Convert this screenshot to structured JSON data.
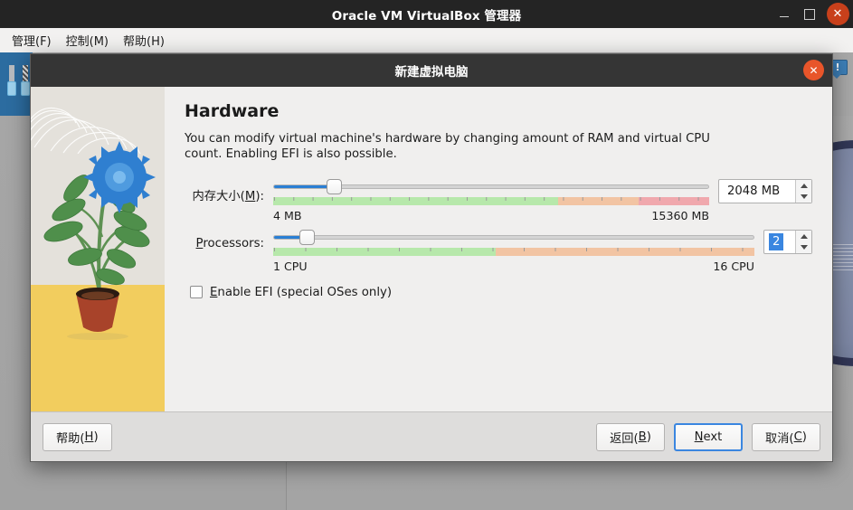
{
  "background_window": {
    "title": "Oracle VM VirtualBox 管理器",
    "window_controls": {
      "minimize": "–",
      "maximize": "□",
      "close": "✕"
    },
    "menu": [
      {
        "label": "管理(F)",
        "mnemonic": "F"
      },
      {
        "label": "控制(M)",
        "mnemonic": "M"
      },
      {
        "label": "帮助(H)",
        "mnemonic": "H"
      }
    ],
    "notification_icon": "!",
    "icons": {
      "toolbar": "tools-icon",
      "notification": "notification-bubble-icon",
      "logo": "virtualbox-logo-icon"
    }
  },
  "dialog": {
    "title": "新建虚拟电脑",
    "close_label": "✕",
    "page_title": "Hardware",
    "page_description": "You can modify virtual machine's hardware by changing amount of RAM and virtual CPU count. Enabling EFI is also possible.",
    "memory": {
      "label": "内存大小(M):",
      "label_main": "内存大小(",
      "label_mnemonic": "M",
      "label_tail": "):",
      "value": "2048 MB",
      "min_label": "4 MB",
      "max_label": "15360 MB",
      "min": 4,
      "max": 15360,
      "current": 2048,
      "handle_percent": 13.8,
      "band": {
        "green_end_percent": 65.4,
        "orange_end_percent": 83.9,
        "red_end_percent": 100
      },
      "spin_up": "▲",
      "spin_down": "▼"
    },
    "processors": {
      "label": "Processors:",
      "label_mnemonic": "P",
      "label_tail": "rocessors:",
      "value": "2",
      "value_selected": true,
      "min_label": "1 CPU",
      "max_label": "16 CPU",
      "min": 1,
      "max": 16,
      "current": 2,
      "handle_percent": 6.9,
      "band": {
        "green_end_percent": 46.2,
        "orange_end_percent": 100
      },
      "spin_up": "▲",
      "spin_down": "▼"
    },
    "efi": {
      "label": "Enable EFI (special OSes only)",
      "label_mnemonic": "E",
      "label_tail": "nable EFI (special OSes only)",
      "checked": false
    },
    "buttons": {
      "help": {
        "text": "帮助(H)",
        "prefix": "帮助(",
        "mnemonic": "H",
        "suffix": ")"
      },
      "back": {
        "text": "返回(B)",
        "prefix": "返回(",
        "mnemonic": "B",
        "suffix": ")"
      },
      "next": {
        "text": "Next",
        "prefix": "",
        "mnemonic": "N",
        "suffix": "ext",
        "focused": true
      },
      "cancel": {
        "text": "取消(C)",
        "prefix": "取消(",
        "mnemonic": "C",
        "suffix": ")"
      }
    }
  },
  "colors": {
    "accent_blue": "#2a7fd4",
    "focus_blue": "#3a86e0",
    "close_red": "#e8552a",
    "band_green": "#b7e8ab",
    "band_orange": "#f2c4a3",
    "band_red": "#f0a8ad",
    "titlebar_dark": "#353535",
    "illustration_sky": "#e4e1db",
    "illustration_ground": "#f2cd5e",
    "flower_blue": "#2f7fd0"
  }
}
